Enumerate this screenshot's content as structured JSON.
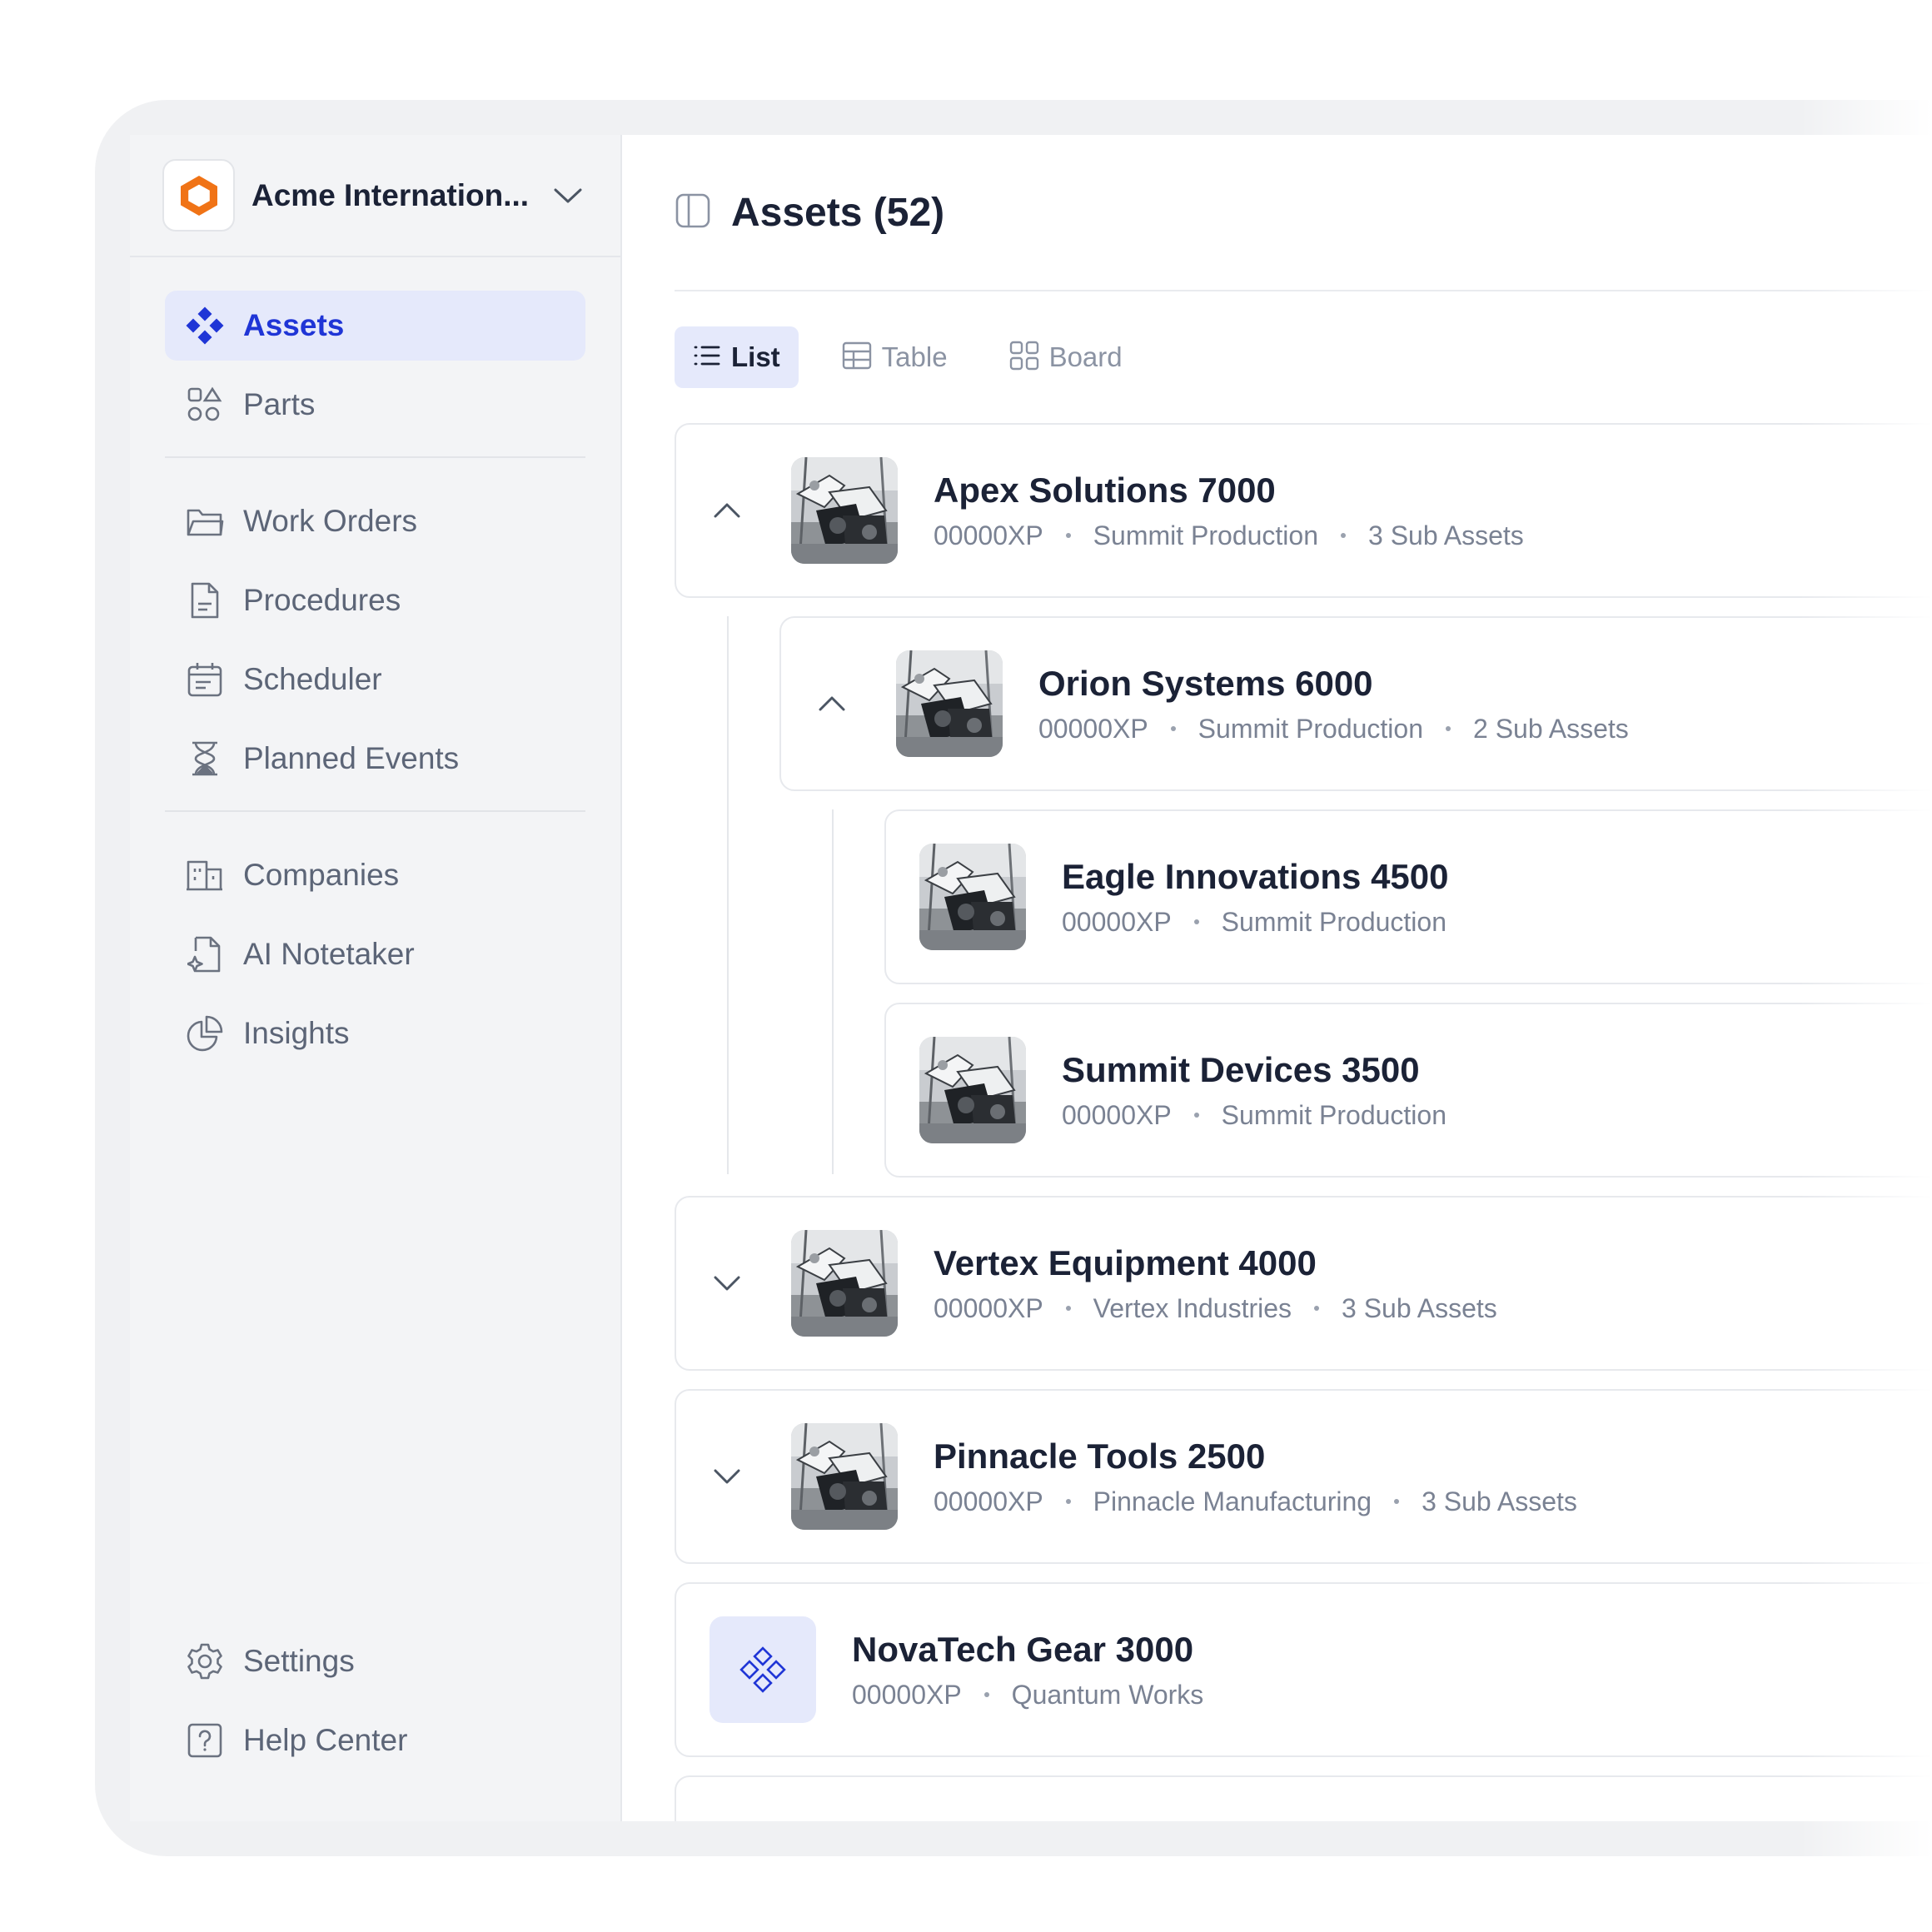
{
  "org": {
    "name": "Acme Internation...",
    "logo_color": "#f07316"
  },
  "nav": {
    "primary": [
      {
        "label": "Assets",
        "icon": "assets-icon",
        "active": true
      },
      {
        "label": "Parts",
        "icon": "parts-icon"
      }
    ],
    "work": [
      {
        "label": "Work Orders",
        "icon": "folder-icon"
      },
      {
        "label": "Procedures",
        "icon": "document-icon"
      },
      {
        "label": "Scheduler",
        "icon": "calendar-icon"
      },
      {
        "label": "Planned Events",
        "icon": "hourglass-icon"
      }
    ],
    "other": [
      {
        "label": "Companies",
        "icon": "building-icon"
      },
      {
        "label": "AI Notetaker",
        "icon": "ai-note-icon"
      },
      {
        "label": "Insights",
        "icon": "pie-chart-icon"
      }
    ],
    "bottom": [
      {
        "label": "Settings",
        "icon": "gear-icon"
      },
      {
        "label": "Help Center",
        "icon": "help-icon"
      }
    ]
  },
  "page": {
    "title": "Assets (52)"
  },
  "views": [
    {
      "label": "List",
      "icon": "list-icon",
      "active": true
    },
    {
      "label": "Table",
      "icon": "table-icon"
    },
    {
      "label": "Board",
      "icon": "board-icon"
    }
  ],
  "assets": [
    {
      "name": "Apex Solutions 7000",
      "code": "00000XP",
      "company": "Summit Production",
      "sub": "3 Sub Assets",
      "level": 0,
      "caret": "up"
    },
    {
      "name": "Orion Systems 6000",
      "code": "00000XP",
      "company": "Summit Production",
      "sub": "2 Sub Assets",
      "level": 1,
      "caret": "up"
    },
    {
      "name": "Eagle Innovations 4500",
      "code": "00000XP",
      "company": "Summit Production",
      "level": 2
    },
    {
      "name": "Summit Devices 3500",
      "code": "00000XP",
      "company": "Summit Production",
      "level": 2
    },
    {
      "name": "Vertex Equipment 4000",
      "code": "00000XP",
      "company": "Vertex Industries",
      "sub": "3 Sub Assets",
      "level": 0,
      "caret": "down"
    },
    {
      "name": "Pinnacle Tools 2500",
      "code": "00000XP",
      "company": "Pinnacle Manufacturing",
      "sub": "3 Sub Assets",
      "level": 0,
      "caret": "down"
    },
    {
      "name": "NovaTech Gear 3000",
      "code": "00000XP",
      "company": "Quantum Works",
      "level": 0,
      "icon_thumb": true
    }
  ],
  "colors": {
    "accent": "#1f35d6",
    "accent_bg": "#e5e9fb",
    "text": "#1b2236",
    "muted": "#5c6577"
  }
}
